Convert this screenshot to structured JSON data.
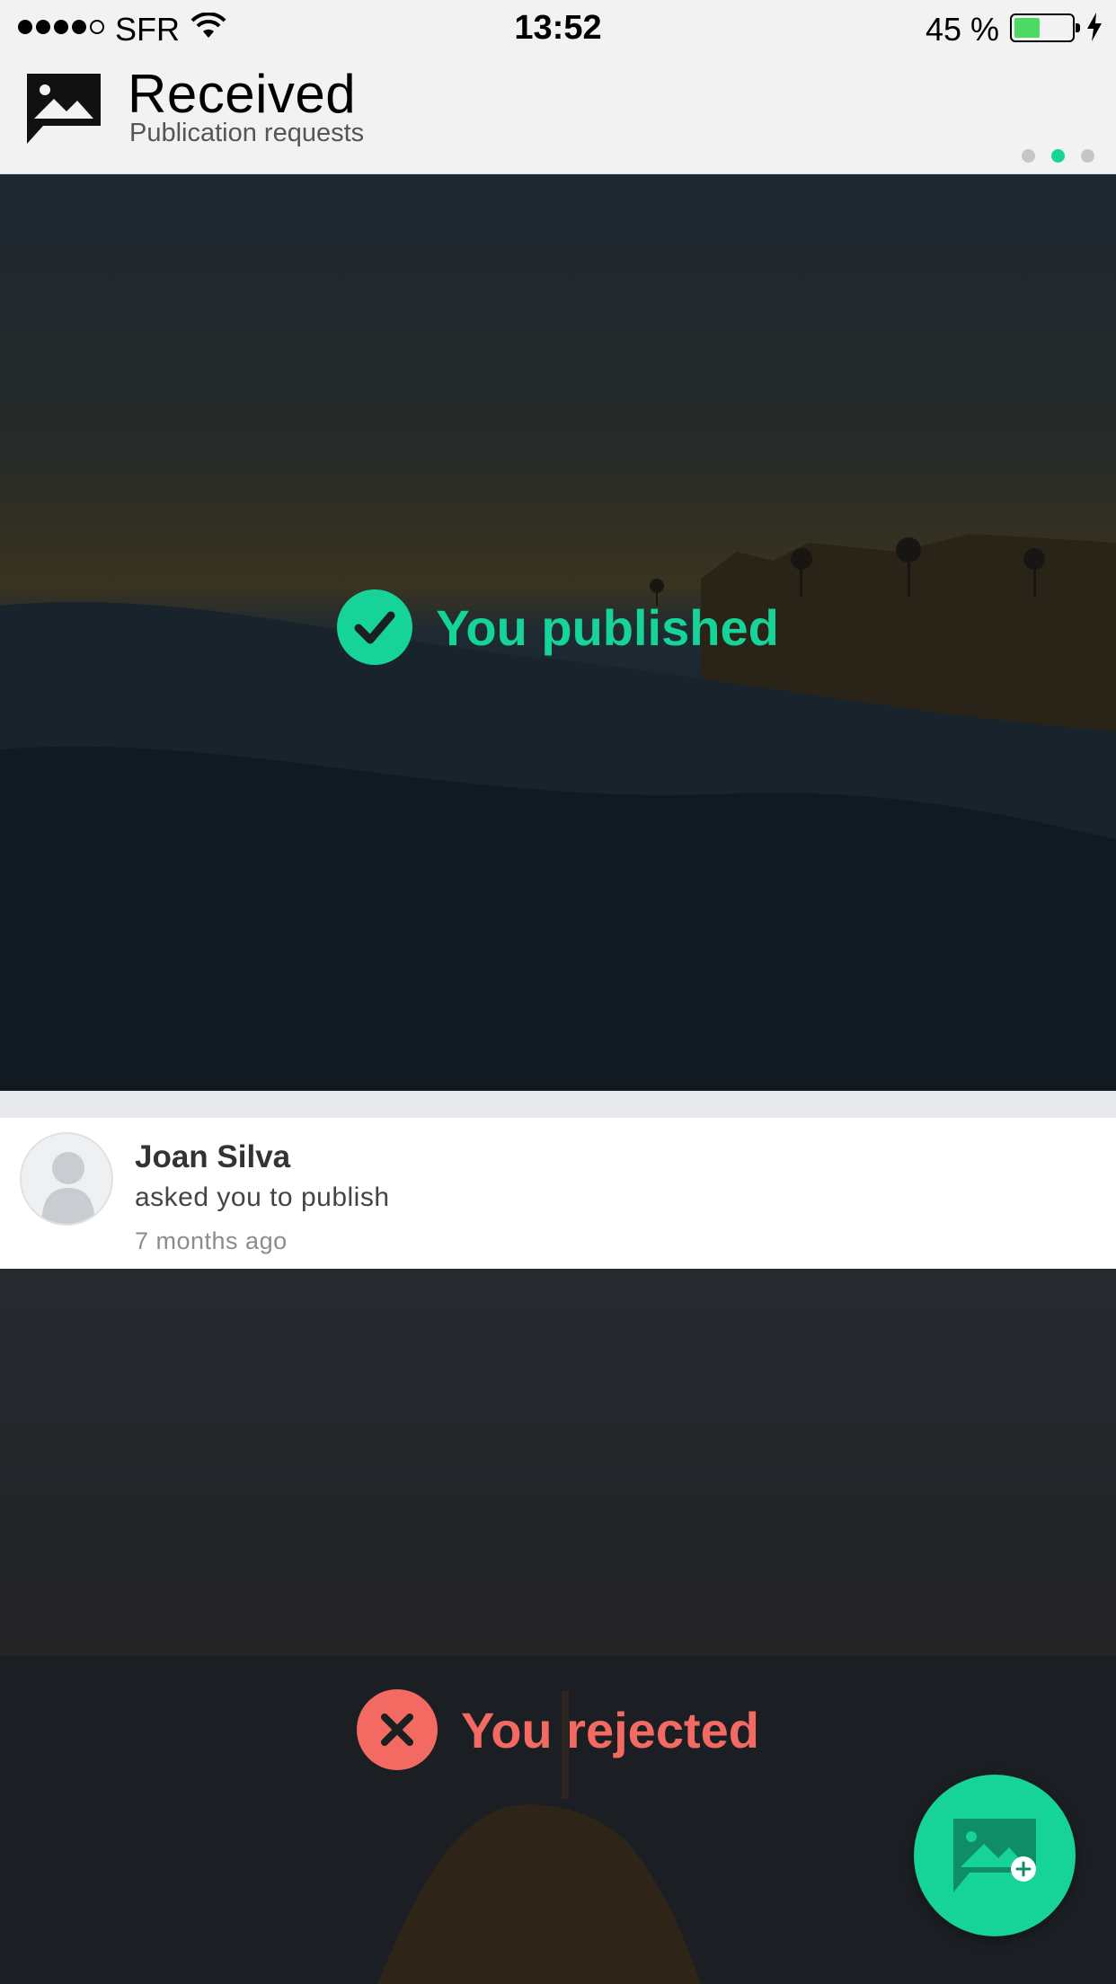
{
  "status_bar": {
    "carrier": "SFR",
    "time": "13:52",
    "battery_percent": "45 %",
    "battery_level": 0.45
  },
  "header": {
    "title": "Received",
    "subtitle": "Publication requests",
    "pager_total": 3,
    "pager_active_index": 1
  },
  "cards": [
    {
      "status": "You published",
      "status_icon": "check-icon",
      "color": "#16d497"
    },
    {
      "status": "You rejected",
      "status_icon": "close-icon",
      "color": "#f26a61"
    }
  ],
  "request": {
    "name": "Joan Silva",
    "action": "asked you to publish",
    "time": "7 months ago"
  },
  "fab": {
    "icon": "add-image-icon"
  },
  "colors": {
    "accent": "#16d497",
    "reject": "#f26a61",
    "header_bg": "#f2f2f2"
  }
}
